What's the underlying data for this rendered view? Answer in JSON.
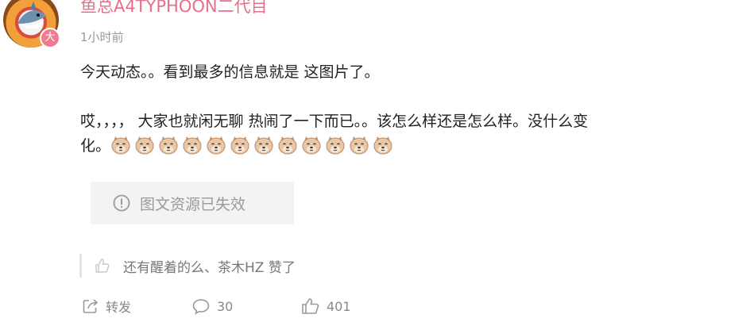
{
  "post": {
    "username": "鱼总A4TYPHOON二代目",
    "badge": "大",
    "time": "1小时前",
    "line1": "今天动态。。看到最多的信息就是 这图片了。",
    "line2": "哎，，，，  大家也就闲无聊 热闹了一下而已。。该怎么样还是怎么样。没什么变",
    "line3_prefix": "化。",
    "emoji_count": 12,
    "media_failed": "图文资源已失效",
    "likers_text": "还有醒着的么、茶木HZ 赞了"
  },
  "actions": {
    "share_label": "转发",
    "comment_count": "30",
    "like_count": "401"
  },
  "colors": {
    "username": "#e86f8a",
    "meta": "#999999",
    "icon": "#aaaaaa"
  }
}
